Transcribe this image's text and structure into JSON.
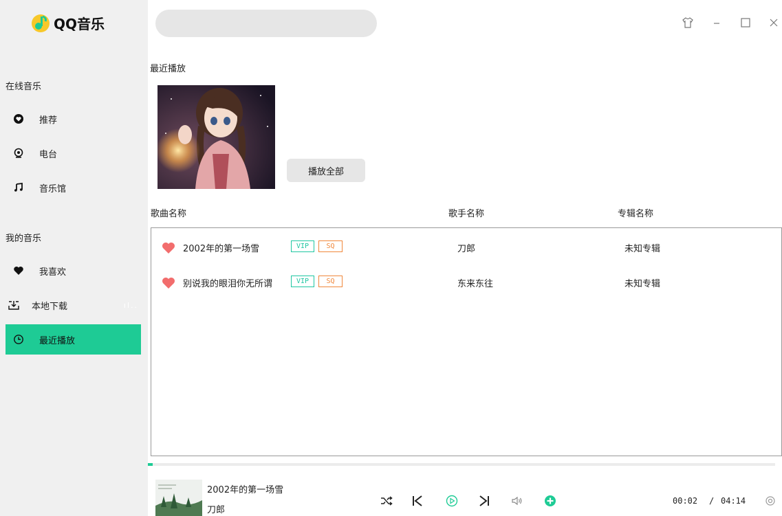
{
  "app": {
    "logo_text": "QQ音乐"
  },
  "search": {
    "value": "",
    "placeholder": ""
  },
  "sidebar": {
    "online_title": "在线音乐",
    "online_items": [
      {
        "label": "推荐",
        "icon": "heart-circle-icon"
      },
      {
        "label": "电台",
        "icon": "radio-icon"
      },
      {
        "label": "音乐馆",
        "icon": "music-note-icon"
      }
    ],
    "mine_title": "我的音乐",
    "mine_items": [
      {
        "label": "我喜欢",
        "icon": "heart-icon"
      },
      {
        "label": "本地下载",
        "icon": "download-icon",
        "badge": "ıl.."
      },
      {
        "label": "最近播放",
        "icon": "clock-icon",
        "active": true
      }
    ]
  },
  "main": {
    "title": "最近播放",
    "play_all": "播放全部",
    "columns": {
      "song": "歌曲名称",
      "artist": "歌手名称",
      "album": "专辑名称"
    },
    "songs": [
      {
        "title": "2002年的第一场雪",
        "vip": "VIP",
        "sq": "SQ",
        "artist": "刀郎",
        "album": "未知专辑"
      },
      {
        "title": "别说我的眼泪你无所谓",
        "vip": "VIP",
        "sq": "SQ",
        "artist": "东来东往",
        "album": "未知专辑"
      }
    ]
  },
  "player": {
    "title": "2002年的第一场雪",
    "artist": "刀郎",
    "current_time": "00:02",
    "separator": "/",
    "total_time": "04:14",
    "progress": 0.008
  },
  "colors": {
    "accent": "#1ecb95",
    "vip": "#1ec6a1",
    "sq": "#f0873a",
    "heart": "#f26d6d"
  }
}
